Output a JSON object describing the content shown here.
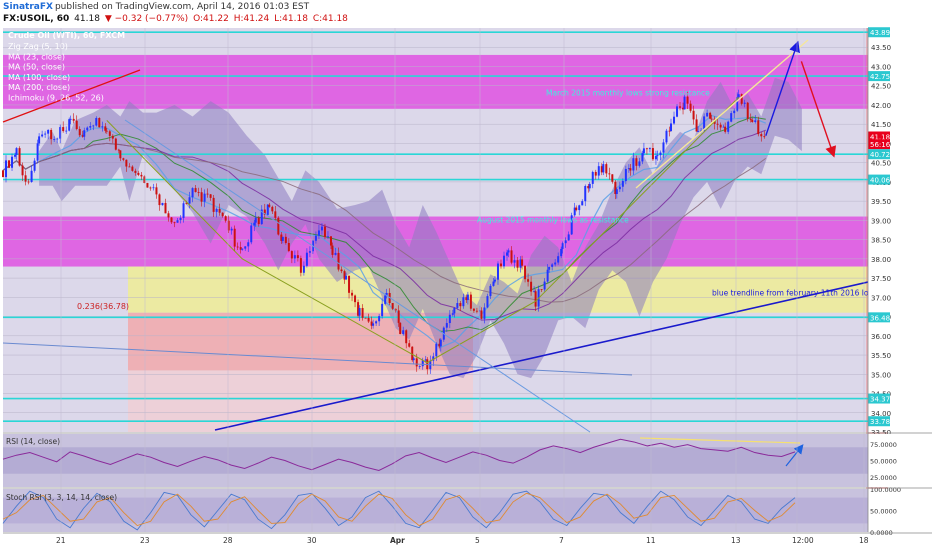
{
  "header": {
    "author": "SinatraFX",
    "published_text": "published on TradingView.com, April 14, 2016 01:03 EST",
    "symbol": "FX:USOIL, 60",
    "last": "41.18",
    "change": "▼ −0.32 (−0.77%)",
    "open": "O:41.22",
    "high": "H:41.24",
    "low": "L:41.18",
    "close": "C:41.18"
  },
  "colors": {
    "magenta_zone": "#e040e0",
    "yellow_zone": "#f0ef90",
    "red_zone": "#f4a3a3",
    "cloud": "#8c7bbf",
    "bull_candle": "#2233ff",
    "bear_candle": "#cc1111",
    "ma_fast": "#5aa0e8",
    "horizontal_level": "#2ad6d6",
    "trendline": "#1a1acc",
    "price_tag": "#e8001c"
  },
  "chart_data": [
    {
      "type": "candlestick",
      "title": "Crude Oil (WTI), 60, FXCM",
      "indicators": [
        "Zig Zag (5, 10)",
        "MA (23, close)",
        "MA (50, close)",
        "MA (100, close)",
        "MA (200, close)",
        "Ichimoku (9, 26, 52, 26)"
      ],
      "x_tick_labels": [
        "21",
        "23",
        "28",
        "30",
        "Apr",
        "5",
        "7",
        "11",
        "13",
        "12:00",
        "18"
      ],
      "y_tick_labels": [
        "43.50",
        "43.00",
        "42.50",
        "42.00",
        "41.50",
        "41.00",
        "40.50",
        "40.00",
        "39.50",
        "39.00",
        "38.50",
        "38.00",
        "37.50",
        "37.00",
        "36.50",
        "36.00",
        "35.50",
        "35.00",
        "34.50",
        "34.00",
        "33.50"
      ],
      "ylim": [
        33.5,
        44.0
      ],
      "price_tags": [
        {
          "label": "43.89",
          "value": 43.89
        },
        {
          "label": "42.75",
          "value": 42.75
        },
        {
          "label": "41.18",
          "value": 41.18
        },
        {
          "label": "56:16",
          "value": 40.98
        },
        {
          "label": "40.72",
          "value": 40.72
        },
        {
          "label": "40.06",
          "value": 40.06
        },
        {
          "label": "36.48",
          "value": 36.48
        },
        {
          "label": "34.37",
          "value": 34.37
        },
        {
          "label": "33.78",
          "value": 33.78
        }
      ],
      "levels": [
        43.89,
        42.75,
        40.72,
        40.06,
        36.48,
        34.37,
        33.78
      ],
      "fib_labels": [
        {
          "label": "0.236(36.78)",
          "value": 36.78
        }
      ],
      "annotations": [
        {
          "text": "March 2015 monthly lows strong resistance",
          "value": 42.25
        },
        {
          "text": "August 2015 monthly lows as resistance",
          "value": 38.95
        },
        {
          "text": "blue trendline from february 11th 2016 lows",
          "value": 37.05
        }
      ],
      "close_path": [
        {
          "x": 0,
          "close": 40.3
        },
        {
          "x": 3,
          "close": 40.8
        },
        {
          "x": 5,
          "close": 39.9
        },
        {
          "x": 8,
          "close": 41.1
        },
        {
          "x": 12,
          "close": 41.3
        },
        {
          "x": 15,
          "close": 41.5
        },
        {
          "x": 18,
          "close": 41.2
        },
        {
          "x": 20,
          "close": 41.6
        },
        {
          "x": 23,
          "close": 41.3
        },
        {
          "x": 26,
          "close": 40.7
        },
        {
          "x": 30,
          "close": 40.2
        },
        {
          "x": 34,
          "close": 39.6
        },
        {
          "x": 38,
          "close": 38.8
        },
        {
          "x": 42,
          "close": 39.8
        },
        {
          "x": 46,
          "close": 39.5
        },
        {
          "x": 50,
          "close": 38.8
        },
        {
          "x": 53,
          "close": 38.1
        },
        {
          "x": 56,
          "close": 39.0
        },
        {
          "x": 59,
          "close": 39.3
        },
        {
          "x": 62,
          "close": 38.4
        },
        {
          "x": 66,
          "close": 37.8
        },
        {
          "x": 70,
          "close": 38.9
        },
        {
          "x": 73,
          "close": 38.2
        },
        {
          "x": 76,
          "close": 37.4
        },
        {
          "x": 79,
          "close": 36.6
        },
        {
          "x": 82,
          "close": 36.3
        },
        {
          "x": 85,
          "close": 37.1
        },
        {
          "x": 88,
          "close": 36.2
        },
        {
          "x": 91,
          "close": 35.4
        },
        {
          "x": 94,
          "close": 35.3
        },
        {
          "x": 97,
          "close": 35.9
        },
        {
          "x": 100,
          "close": 36.8
        },
        {
          "x": 103,
          "close": 36.9
        },
        {
          "x": 106,
          "close": 36.6
        },
        {
          "x": 109,
          "close": 37.6
        },
        {
          "x": 112,
          "close": 38.1
        },
        {
          "x": 115,
          "close": 37.8
        },
        {
          "x": 118,
          "close": 36.9
        },
        {
          "x": 121,
          "close": 37.8
        },
        {
          "x": 124,
          "close": 38.4
        },
        {
          "x": 127,
          "close": 39.3
        },
        {
          "x": 130,
          "close": 40.0
        },
        {
          "x": 133,
          "close": 40.4
        },
        {
          "x": 136,
          "close": 39.7
        },
        {
          "x": 139,
          "close": 40.4
        },
        {
          "x": 142,
          "close": 40.8
        },
        {
          "x": 145,
          "close": 40.6
        },
        {
          "x": 148,
          "close": 41.6
        },
        {
          "x": 151,
          "close": 42.1
        },
        {
          "x": 154,
          "close": 41.4
        },
        {
          "x": 157,
          "close": 41.8
        },
        {
          "x": 160,
          "close": 41.2
        },
        {
          "x": 163,
          "close": 42.2
        },
        {
          "x": 166,
          "close": 41.5
        },
        {
          "x": 169,
          "close": 41.2
        }
      ],
      "projection": [
        {
          "x": 169,
          "close": 41.2
        },
        {
          "x": 176,
          "close": 43.6
        },
        {
          "x": 184,
          "close": 40.7
        }
      ]
    },
    {
      "type": "line",
      "title": "RSI (14, close)",
      "y_tick_labels": [
        "75.0000",
        "50.0000",
        "25.0000"
      ],
      "ylim": [
        10,
        90
      ],
      "values": [
        52,
        58,
        62,
        55,
        48,
        63,
        57,
        50,
        44,
        52,
        60,
        55,
        47,
        41,
        49,
        56,
        51,
        43,
        38,
        46,
        55,
        50,
        42,
        36,
        44,
        52,
        47,
        40,
        35,
        45,
        57,
        62,
        54,
        47,
        55,
        63,
        58,
        50,
        46,
        55,
        66,
        72,
        68,
        62,
        70,
        76,
        82,
        78,
        72,
        76,
        70,
        74,
        68,
        66,
        64,
        70,
        62,
        58,
        56,
        63
      ]
    },
    {
      "type": "line",
      "title": "Stoch RSI (3, 3, 14, 14, close)",
      "y_tick_labels": [
        "100.0000",
        "50.0000",
        "0.0000"
      ],
      "ylim": [
        0,
        100
      ],
      "series": [
        {
          "values": [
            20,
            60,
            95,
            80,
            30,
            10,
            55,
            90,
            70,
            25,
            5,
            45,
            92,
            85,
            40,
            12,
            50,
            88,
            75,
            30,
            8,
            40,
            85,
            90,
            55,
            15,
            35,
            80,
            95,
            60,
            20,
            10,
            50,
            92,
            80,
            35,
            10,
            45,
            88,
            95,
            70,
            30,
            15,
            55,
            90,
            85,
            45,
            20,
            60,
            95,
            75,
            35,
            15,
            50,
            85,
            70,
            30,
            20,
            55,
            80
          ]
        },
        {
          "values": [
            30,
            45,
            75,
            85,
            55,
            25,
            30,
            70,
            80,
            45,
            15,
            25,
            70,
            88,
            60,
            25,
            30,
            70,
            82,
            50,
            20,
            22,
            65,
            88,
            72,
            35,
            25,
            60,
            88,
            78,
            40,
            15,
            30,
            75,
            85,
            55,
            22,
            28,
            70,
            90,
            80,
            50,
            22,
            35,
            72,
            88,
            65,
            32,
            40,
            80,
            85,
            55,
            25,
            32,
            70,
            78,
            50,
            25,
            38,
            68
          ]
        }
      ]
    }
  ]
}
